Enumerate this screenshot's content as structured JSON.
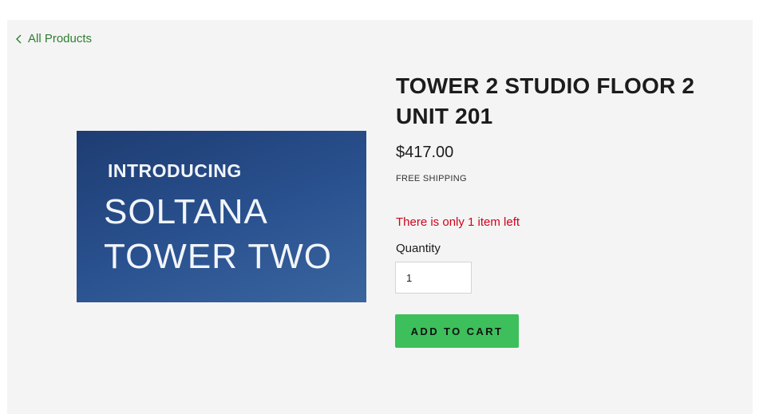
{
  "nav": {
    "back_label": "All Products",
    "back_icon": "chevron-left-icon"
  },
  "product": {
    "image": {
      "line1": "INTRODUCING",
      "line2": "SOLTANA",
      "line3": "TOWER TWO"
    },
    "title": "TOWER 2 STUDIO FLOOR 2 UNIT 201",
    "price": "$417.00",
    "shipping": "FREE SHIPPING",
    "stock_message": "There is only 1 item left",
    "quantity_label": "Quantity",
    "quantity_value": "1",
    "add_to_cart_label": "ADD TO CART"
  },
  "colors": {
    "link": "#2f7d32",
    "stock_warning": "#d0021b",
    "cta": "#3dbf5b",
    "panel_bg": "#f4f4f4"
  }
}
